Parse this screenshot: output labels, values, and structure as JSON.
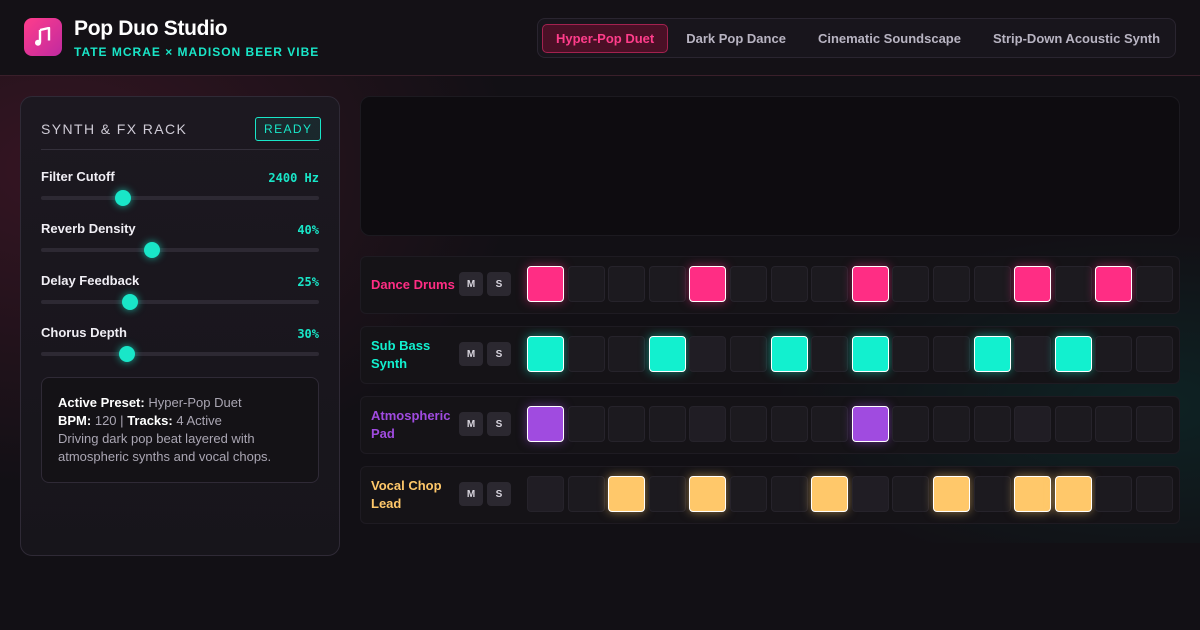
{
  "header": {
    "app_title": "Pop Duo Studio",
    "app_subtitle": "TATE MCRAE × MADISON BEER VIBE",
    "logo_icon": "music-note-icon",
    "tabs": [
      {
        "label": "Hyper-Pop Duet",
        "active": true
      },
      {
        "label": "Dark Pop Dance",
        "active": false
      },
      {
        "label": "Cinematic Soundscape",
        "active": false
      },
      {
        "label": "Strip-Down Acoustic Synth",
        "active": false
      }
    ]
  },
  "rack": {
    "title": "SYNTH & FX RACK",
    "status": "READY",
    "sliders": [
      {
        "label": "Filter Cutoff",
        "value": "2400 Hz",
        "level": 0.295
      },
      {
        "label": "Reverb Density",
        "value": "40%",
        "level": 0.4
      },
      {
        "label": "Delay Feedback",
        "value": "25%",
        "level": 0.32
      },
      {
        "label": "Chorus Depth",
        "value": "30%",
        "level": 0.31
      }
    ],
    "info": {
      "active_preset_label": "Active Preset:",
      "active_preset": "Hyper-Pop Duet",
      "bpm_label": "BPM:",
      "bpm": "120",
      "separator": "|",
      "tracks_label": "Tracks:",
      "tracks": "4 Active",
      "description": "Driving dark pop beat layered with atmospheric synths and vocal chops."
    }
  },
  "sequencer": {
    "mute_label": "M",
    "solo_label": "S",
    "tracks": [
      {
        "name": "Dance Drums",
        "color": "#ff2d84",
        "steps": [
          1,
          0,
          0,
          0,
          1,
          0,
          0,
          0,
          1,
          0,
          0,
          0,
          1,
          0,
          1,
          0
        ]
      },
      {
        "name": "Sub Bass Synth",
        "color": "#12f0cf",
        "steps": [
          1,
          0,
          0,
          1,
          0,
          0,
          1,
          0,
          1,
          0,
          0,
          1,
          0,
          1,
          0,
          0
        ]
      },
      {
        "name": "Atmospheric Pad",
        "color": "#a04be0",
        "steps": [
          1,
          0,
          0,
          0,
          0,
          0,
          0,
          0,
          1,
          0,
          0,
          0,
          0,
          0,
          0,
          0
        ]
      },
      {
        "name": "Vocal Chop Lead",
        "color": "#ffc86a",
        "steps": [
          0,
          0,
          1,
          0,
          1,
          0,
          0,
          1,
          0,
          0,
          1,
          0,
          1,
          1,
          0,
          0
        ]
      }
    ]
  },
  "colors": {
    "accent_pink": "#ff3d8b",
    "accent_teal": "#19e6c8"
  }
}
